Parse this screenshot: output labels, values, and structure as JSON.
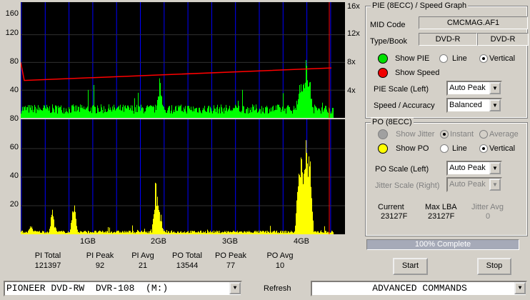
{
  "chart_top": {
    "left_ticks": [
      "160",
      "120",
      "80",
      "40"
    ],
    "right_ticks": [
      "16x",
      "12x",
      "8x",
      "4x"
    ]
  },
  "chart_bottom": {
    "left_ticks": [
      "80",
      "60",
      "40",
      "20"
    ]
  },
  "x_ticks": [
    "1GB",
    "2GB",
    "3GB",
    "4GB"
  ],
  "chart_data": [
    {
      "type": "bar",
      "name": "PIE",
      "ylim": [
        0,
        160
      ],
      "xlim_gb": [
        0,
        4.46
      ],
      "baseline": 15,
      "spikes": [
        [
          0.0,
          45
        ],
        [
          2.0,
          70
        ],
        [
          3.95,
          50
        ],
        [
          4.05,
          92
        ],
        [
          4.1,
          60
        ]
      ],
      "speed_line": {
        "x_gb": [
          0,
          0.05,
          4.35
        ],
        "speed_x": [
          8,
          5.4,
          7.2
        ]
      },
      "colors": {
        "bars": "#00ff00",
        "speed": "#ff0000",
        "grid": "#0000ff"
      }
    },
    {
      "type": "bar",
      "name": "PO",
      "ylim": [
        0,
        80
      ],
      "xlim_gb": [
        0,
        4.46
      ],
      "baseline": 2,
      "spikes": [
        [
          0.2,
          8
        ],
        [
          0.5,
          18
        ],
        [
          0.8,
          26
        ],
        [
          1.95,
          44
        ],
        [
          2.0,
          22
        ],
        [
          3.95,
          50
        ],
        [
          4.05,
          77
        ],
        [
          4.1,
          60
        ]
      ],
      "colors": {
        "bars": "#ffff00",
        "grid": "#0000ff"
      }
    }
  ],
  "stats": [
    {
      "label": "PI Total",
      "value": "121397"
    },
    {
      "label": "PI Peak",
      "value": "92"
    },
    {
      "label": "PI Avg",
      "value": "21"
    },
    {
      "label": "PO Total",
      "value": "13544"
    },
    {
      "label": "PO Peak",
      "value": "77"
    },
    {
      "label": "PO Avg",
      "value": "10"
    }
  ],
  "pie_group": {
    "title": "PIE (8ECC) / Speed Graph",
    "mid_label": "MID Code",
    "mid_value": "CMCMAG.AF1",
    "type_label": "Type/Book",
    "type_value": "DVD-R",
    "book_value": "DVD-R",
    "show_pie": "Show PIE",
    "show_speed": "Show Speed",
    "line": "Line",
    "vertical": "Vertical",
    "scale_label": "PIE Scale (Left)",
    "scale_value": "Auto Peak",
    "speed_label": "Speed / Accuracy",
    "speed_value": "Balanced"
  },
  "po_group": {
    "title": "PO (8ECC)",
    "show_jitter": "Show Jitter",
    "instant": "Instant",
    "average": "Average",
    "show_po": "Show PO",
    "line": "Line",
    "vertical": "Vertical",
    "scale_label": "PO Scale (Left)",
    "scale_value": "Auto Peak",
    "jitter_label": "Jitter Scale (Right)",
    "jitter_value": "Auto Peak",
    "current_label": "Current",
    "current_value": "23127F",
    "maxlba_label": "Max LBA",
    "maxlba_value": "23127F",
    "javg_label": "Jitter Avg",
    "javg_value": "0"
  },
  "progress": {
    "text": "100% Complete",
    "percent": 100
  },
  "buttons": {
    "start": "Start",
    "stop": "Stop",
    "refresh": "Refresh"
  },
  "drive": "PIONEER DVD-RW  DVR-108  (M:)",
  "commands": "ADVANCED COMMANDS"
}
